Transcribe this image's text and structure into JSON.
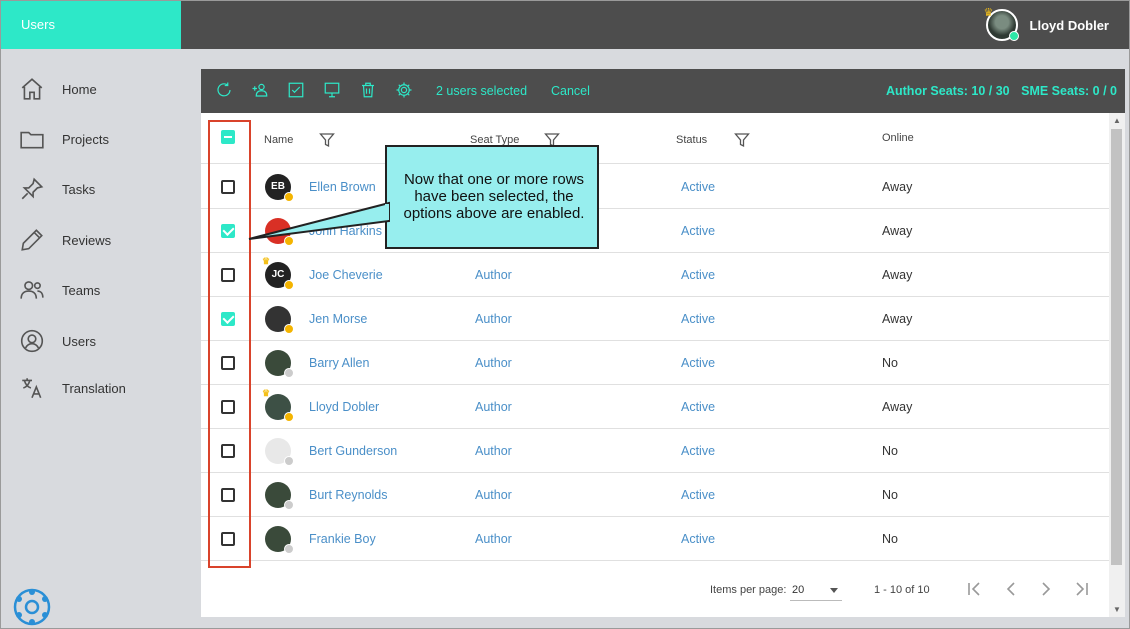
{
  "app": {
    "title": "Users"
  },
  "user": {
    "name": "Lloyd Dobler"
  },
  "sidebar": {
    "items": [
      {
        "label": "Home",
        "icon": "home-icon"
      },
      {
        "label": "Projects",
        "icon": "folder-icon"
      },
      {
        "label": "Tasks",
        "icon": "pin-icon"
      },
      {
        "label": "Reviews",
        "icon": "pen-icon"
      },
      {
        "label": "Teams",
        "icon": "people-icon"
      },
      {
        "label": "Users",
        "icon": "user-circle-icon"
      },
      {
        "label": "Translation",
        "icon": "translate-icon"
      }
    ]
  },
  "toolbar": {
    "selected_text": "2 users selected",
    "cancel_label": "Cancel",
    "author_seats_label": "Author Seats: 10 / 30",
    "sme_seats_label": "SME Seats: 0 / 0",
    "buttons": [
      "refresh-icon",
      "add-user-icon",
      "checklist-icon",
      "monitor-icon",
      "trash-icon",
      "gear-icon"
    ]
  },
  "table": {
    "headers": {
      "name": "Name",
      "seat_type": "Seat Type",
      "status": "Status",
      "online": "Online"
    },
    "rows": [
      {
        "initials": "EB",
        "name": "Ellen Brown",
        "seat_type": "",
        "status": "Active",
        "online": "Away",
        "checked": false,
        "avatar_color": "#222222",
        "presence_color": "#f4b400",
        "crown": false
      },
      {
        "initials": "",
        "name": "John Harkins",
        "seat_type": "",
        "status": "Active",
        "online": "Away",
        "checked": true,
        "avatar_color": "#d93025",
        "presence_color": "#f4b400",
        "crown": false
      },
      {
        "initials": "JC",
        "name": "Joe Cheverie",
        "seat_type": "Author",
        "status": "Active",
        "online": "Away",
        "checked": false,
        "avatar_color": "#222222",
        "presence_color": "#f4b400",
        "crown": true
      },
      {
        "initials": "",
        "name": "Jen Morse",
        "seat_type": "Author",
        "status": "Active",
        "online": "Away",
        "checked": true,
        "avatar_color": "#333333",
        "presence_color": "#f4b400",
        "crown": false
      },
      {
        "initials": "",
        "name": "Barry Allen",
        "seat_type": "Author",
        "status": "Active",
        "online": "No",
        "checked": false,
        "avatar_color": "#3a4a3a",
        "presence_color": "#cccccc",
        "crown": false
      },
      {
        "initials": "",
        "name": "Lloyd Dobler",
        "seat_type": "Author",
        "status": "Active",
        "online": "Away",
        "checked": false,
        "avatar_color": "#3d5045",
        "presence_color": "#f4b400",
        "crown": true
      },
      {
        "initials": "",
        "name": "Bert Gunderson",
        "seat_type": "Author",
        "status": "Active",
        "online": "No",
        "checked": false,
        "avatar_color": "#e8e8e8",
        "presence_color": "#cccccc",
        "crown": false
      },
      {
        "initials": "",
        "name": "Burt Reynolds",
        "seat_type": "Author",
        "status": "Active",
        "online": "No",
        "checked": false,
        "avatar_color": "#3a4a3a",
        "presence_color": "#cccccc",
        "crown": false
      },
      {
        "initials": "",
        "name": "Frankie Boy",
        "seat_type": "Author",
        "status": "Active",
        "online": "No",
        "checked": false,
        "avatar_color": "#3a4a3a",
        "presence_color": "#cccccc",
        "crown": false
      }
    ]
  },
  "paginator": {
    "items_per_page_label": "Items per page:",
    "page_size": "20",
    "range_label": "1 - 10 of 10"
  },
  "callout": {
    "text": "Now that one or more rows have been selected, the options above are enabled."
  },
  "colors": {
    "accent": "#2de8c8",
    "link": "#4a8fc8",
    "dark_bar": "#4d4d4d",
    "highlight_box": "#d9432b",
    "callout_bg": "#97eeee"
  }
}
